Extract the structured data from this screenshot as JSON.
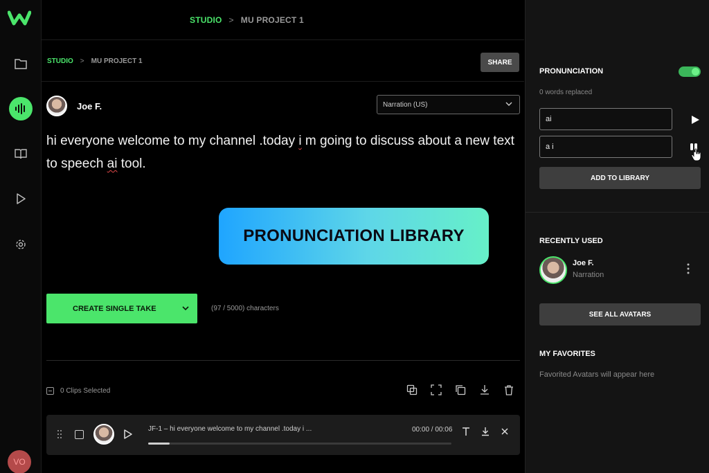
{
  "colors": {
    "accent": "#4be56b",
    "banner_start": "#1fa5ff",
    "banner_end": "#66f0c8"
  },
  "rail": {
    "logo_icon": "brand-logo-icon",
    "items": [
      "folder-icon",
      "waveform-icon",
      "book-icon",
      "play-icon",
      "gear-icon"
    ],
    "user_initials": "VO"
  },
  "topbar": {
    "crumb_studio": "STUDIO",
    "crumb_sep": ">",
    "crumb_project": "MU PROJECT 1"
  },
  "subbar": {
    "crumb_studio": "STUDIO",
    "crumb_sep": ">",
    "crumb_project": "MU PROJECT 1",
    "share_label": "SHARE"
  },
  "editor": {
    "speaker_name": "Joe F.",
    "voice_selected": "Narration (US)",
    "script_pre": "hi everyone welcome to my channel .today ",
    "script_i": "i",
    "script_mid": " m going to discuss about a new text to speech ",
    "script_ai": "ai",
    "script_post": " tool.",
    "create_label": "CREATE SINGLE TAKE",
    "char_count": "(97 / 5000) characters"
  },
  "clips": {
    "selected_label": "0 Clips Selected",
    "tools": [
      "merge-icon",
      "expand-icon",
      "copy-icon",
      "download-icon",
      "trash-icon"
    ],
    "row": {
      "title": "JF-1 – hi everyone welcome to my channel .today i ...",
      "time": "00:00 / 00:06",
      "progress": 0.07
    }
  },
  "banner": {
    "text": "PRONUNCIATION LIBRARY"
  },
  "pronunciation": {
    "title": "PRONUNCIATION",
    "enabled": true,
    "words_replaced": "0 words replaced",
    "word_value": "ai",
    "replacement_value": "a i",
    "add_label": "ADD TO LIBRARY"
  },
  "recent": {
    "title": "RECENTLY USED",
    "name": "Joe F.",
    "role": "Narration",
    "see_all_label": "SEE ALL AVATARS"
  },
  "favorites": {
    "title": "MY FAVORITES",
    "empty_text": "Favorited Avatars will appear here"
  }
}
